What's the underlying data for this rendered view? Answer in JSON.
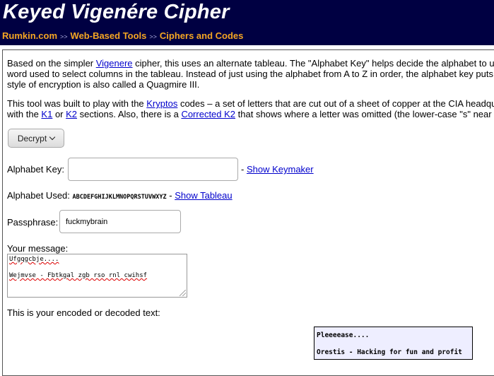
{
  "header": {
    "title": "Keyed Vigenére Cipher",
    "breadcrumb": [
      "Rumkin.com",
      "Web-Based Tools",
      "Ciphers and Codes"
    ],
    "separator": ">>"
  },
  "intro": {
    "p1_line1_a": "Based on the simpler ",
    "p1_line1_link": "Vigenere",
    "p1_line1_b": " cipher, this uses an alternate tableau. The \"Alphabet Key\" helps decide the alphabet to us",
    "p1_line2": "word used to select columns in the tableau. Instead of just using the alphabet from A to Z in order, the alphabet key puts",
    "p1_line3": "style of encryption is also called a Quagmire III.",
    "p2_line1_a": "This tool was built to play with the ",
    "p2_line1_link": "Kryptos",
    "p2_line1_b": " codes – a set of letters that are cut out of a sheet of copper at the CIA headqu",
    "p2_line2_a": "with the ",
    "p2_line2_link1": "K1",
    "p2_line2_b": " or ",
    "p2_line2_link2": "K2",
    "p2_line2_c": " sections. Also, there is a ",
    "p2_line2_link3": "Corrected K2",
    "p2_line2_d": " that shows where a letter was omitted (the lower-case \"s\" near t"
  },
  "mode": {
    "selected": "Decrypt"
  },
  "alphabet_key": {
    "label": "Alphabet Key:",
    "value": "",
    "separator": "-",
    "link": "Show Keymaker"
  },
  "alphabet_used": {
    "label": "Alphabet Used:",
    "value": "ABCDEFGHIJKLMNOPQRSTUVWXYZ",
    "separator": "-",
    "link": "Show Tableau"
  },
  "passphrase": {
    "label": "Passphrase:",
    "value": "fuckmybrain"
  },
  "message": {
    "label": "Your message:",
    "line1": "Ufgqgcbje....",
    "line2": "Wejmvse - Fbtkgal zgb rso rnl cwihsf"
  },
  "output": {
    "label": "This is your encoded or decoded text:",
    "line1": "Pleeeease....",
    "line2": "Orestis - Hacking for fun and profit"
  }
}
